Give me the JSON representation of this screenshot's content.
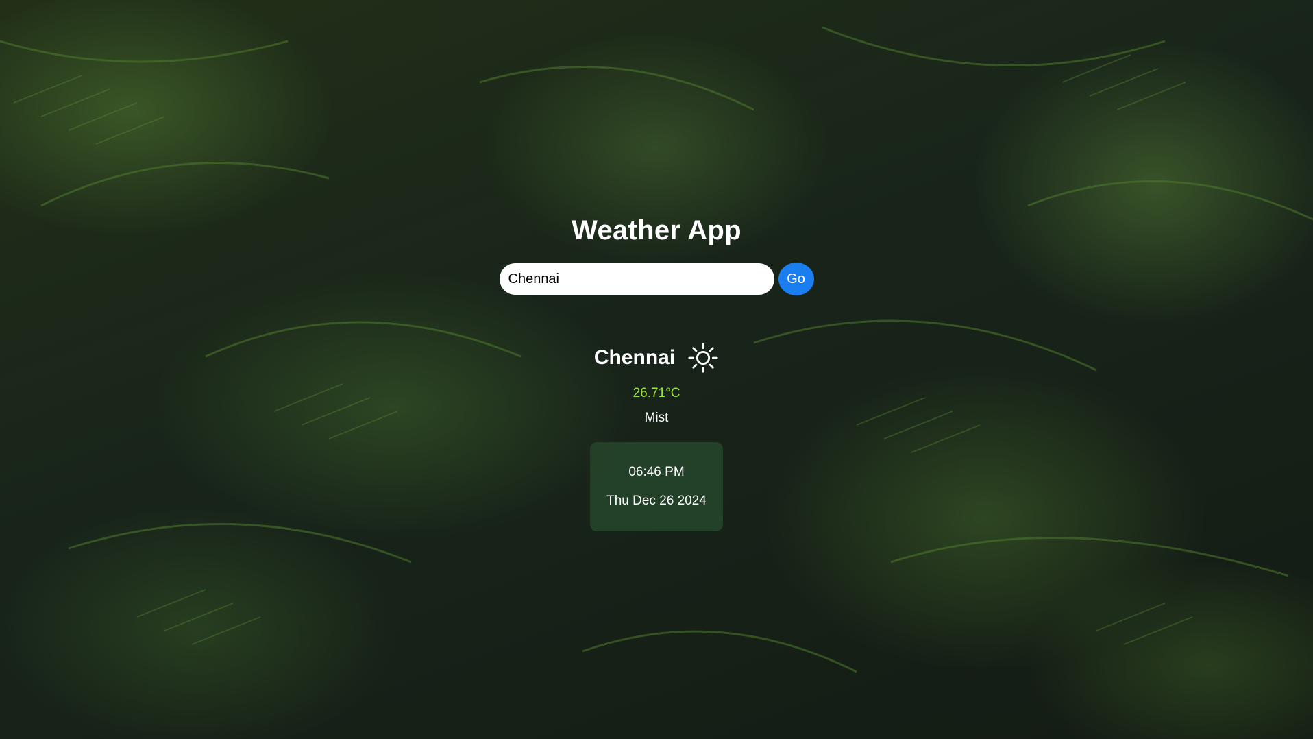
{
  "app": {
    "title": "Weather App"
  },
  "search": {
    "value": "Chennai",
    "go_label": "Go"
  },
  "weather": {
    "city": "Chennai",
    "icon": "sun-icon",
    "temperature": "26.71°C",
    "condition": "Mist"
  },
  "clock": {
    "time": "06:46 PM",
    "date": "Thu Dec 26 2024"
  },
  "colors": {
    "accent_button": "#1a7ef0",
    "temperature_text": "#9ee83a",
    "background": "#18241a"
  }
}
